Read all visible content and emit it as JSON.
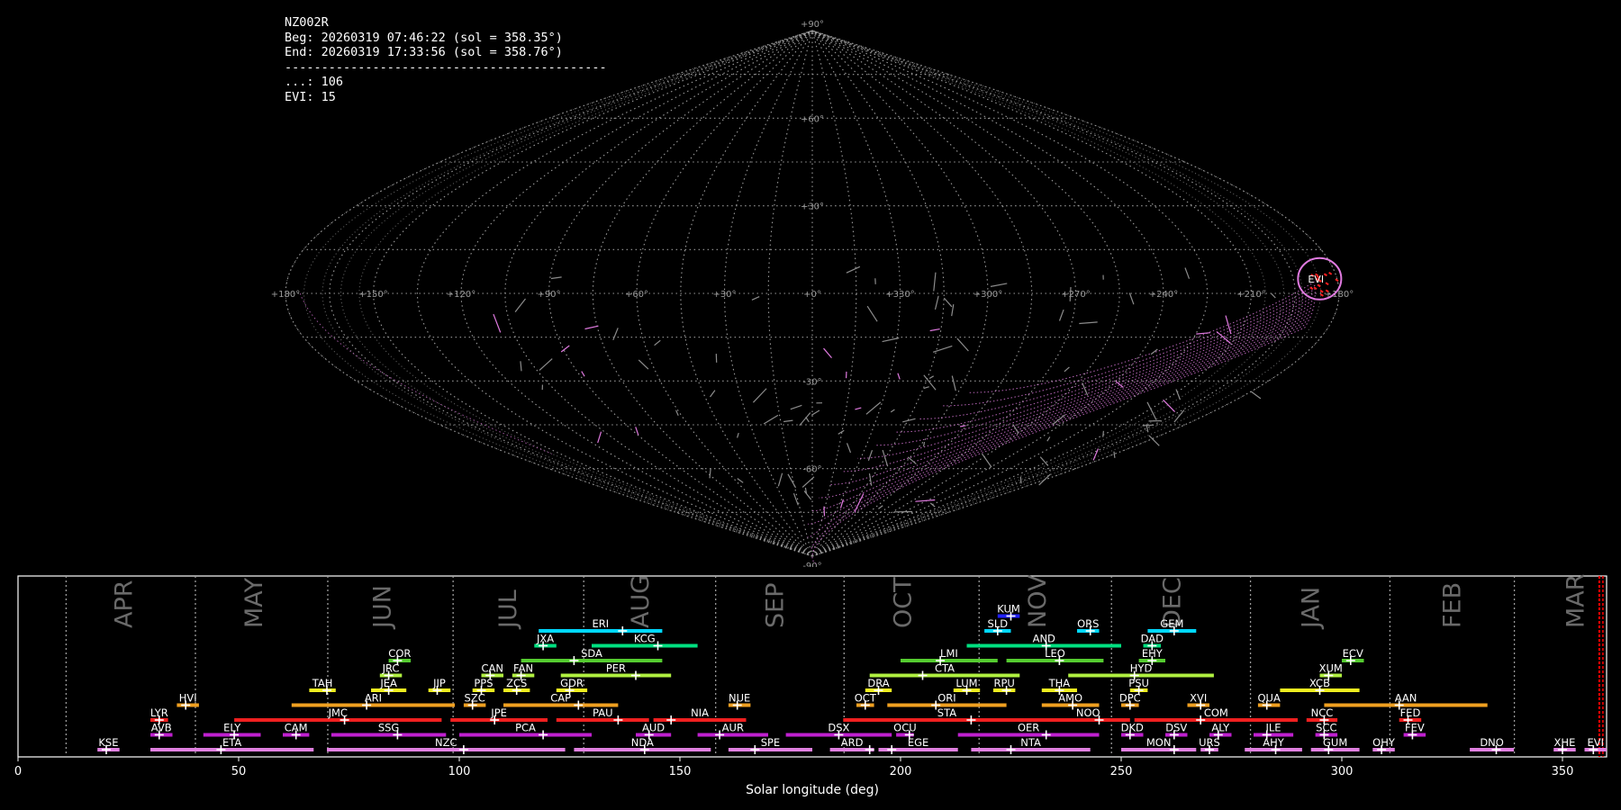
{
  "header": {
    "station": "NZ002R",
    "begin": "Beg: 20260319 07:46:22 (sol = 358.35°)",
    "end": "End: 20260319 17:33:56 (sol = 358.76°)",
    "rule": "--------------------------------------------",
    "count_sporadic": "...: 106",
    "count_evi": "EVI: 15"
  },
  "colors": {
    "background": "#000000",
    "grid": "#9a9a9a",
    "orbit": "#e07ae0",
    "sporadic": "#8c8c8c",
    "radiant_evi": "#ff2020",
    "marker": "#ffffff",
    "current_sol": "#ff0000"
  },
  "chart_data": [
    {
      "type": "scatter",
      "projection": "sinusoidal (equal-area), sky map",
      "lon_labels": [
        "+180°",
        "+150°",
        "+120°",
        "+90°",
        "+60°",
        "+30°",
        "+0°",
        "+330°",
        "+300°",
        "+270°",
        "+240°",
        "+210°",
        "+180°"
      ],
      "lat_labels": [
        "+90°",
        "+60°",
        "+30°",
        "-30°",
        "-60°",
        "-90°"
      ],
      "grid": true,
      "shower_label": "EVI",
      "shower_radiant": {
        "lon": 186,
        "lat": 5
      },
      "meteor_counts": {
        "sporadic": 106,
        "EVI": 15
      }
    },
    {
      "type": "bar",
      "xlabel": "Solar longitude (deg)",
      "xlim": [
        0,
        360
      ],
      "xticks": [
        0,
        50,
        100,
        150,
        200,
        250,
        300,
        350
      ],
      "grid": false,
      "current_sol": 358.35,
      "months": [
        {
          "name": "APR",
          "start": 10.9,
          "mid": 24
        },
        {
          "name": "MAY",
          "start": 40.2,
          "mid": 53.5
        },
        {
          "name": "JUN",
          "start": 70.2,
          "mid": 82.5
        },
        {
          "name": "JUL",
          "start": 98.6,
          "mid": 111
        },
        {
          "name": "AUG",
          "start": 128.2,
          "mid": 141
        },
        {
          "name": "SEP",
          "start": 158.1,
          "mid": 171.5
        },
        {
          "name": "OCT",
          "start": 187.2,
          "mid": 200.5
        },
        {
          "name": "NOV",
          "start": 217.8,
          "mid": 231
        },
        {
          "name": "DEC",
          "start": 247.8,
          "mid": 261.5
        },
        {
          "name": "JAN",
          "start": 279.3,
          "mid": 293
        },
        {
          "name": "FEB",
          "start": 310.9,
          "mid": 325
        },
        {
          "name": "MAR",
          "start": 339.1,
          "mid": 353
        }
      ],
      "showers": [
        {
          "code": "KUM",
          "start": 222,
          "end": 227,
          "peak": 225,
          "row": 9,
          "color": "#2020ff"
        },
        {
          "code": "ERI",
          "start": 118,
          "end": 146,
          "peak": 137,
          "row": 8,
          "color": "#00d8ff"
        },
        {
          "code": "SLD",
          "start": 219,
          "end": 225,
          "peak": 222,
          "row": 8,
          "color": "#00d8ff"
        },
        {
          "code": "ORS",
          "start": 240,
          "end": 245,
          "peak": 243,
          "row": 8,
          "color": "#00d8ff"
        },
        {
          "code": "GEM",
          "start": 256,
          "end": 267,
          "peak": 262,
          "row": 8,
          "color": "#00d8ff"
        },
        {
          "code": "JXA",
          "start": 117,
          "end": 122,
          "peak": 119,
          "row": 7,
          "color": "#00e080"
        },
        {
          "code": "KCG",
          "start": 130,
          "end": 154,
          "peak": 145,
          "row": 7,
          "color": "#00e080"
        },
        {
          "code": "AND",
          "start": 215,
          "end": 250,
          "peak": 233,
          "row": 7,
          "color": "#00e080"
        },
        {
          "code": "DAD",
          "start": 255,
          "end": 259,
          "peak": 257,
          "row": 7,
          "color": "#00e080"
        },
        {
          "code": "COR",
          "start": 84,
          "end": 89,
          "peak": 86,
          "row": 6,
          "color": "#55cc30"
        },
        {
          "code": "SDA",
          "start": 114,
          "end": 146,
          "peak": 126,
          "row": 6,
          "color": "#55cc30"
        },
        {
          "code": "LMI",
          "start": 200,
          "end": 222,
          "peak": 209,
          "row": 6,
          "color": "#55cc30"
        },
        {
          "code": "LEO",
          "start": 224,
          "end": 246,
          "peak": 236,
          "row": 6,
          "color": "#55cc30"
        },
        {
          "code": "EHY",
          "start": 254,
          "end": 260,
          "peak": 257,
          "row": 6,
          "color": "#55cc30"
        },
        {
          "code": "ECV",
          "start": 300,
          "end": 305,
          "peak": 302,
          "row": 6,
          "color": "#55cc30"
        },
        {
          "code": "JRC",
          "start": 82,
          "end": 87,
          "peak": 84,
          "row": 5,
          "color": "#b0f040"
        },
        {
          "code": "CAN",
          "start": 105,
          "end": 110,
          "peak": 107,
          "row": 5,
          "color": "#b0f040"
        },
        {
          "code": "FAN",
          "start": 112,
          "end": 117,
          "peak": 114,
          "row": 5,
          "color": "#b0f040"
        },
        {
          "code": "PER",
          "start": 123,
          "end": 148,
          "peak": 140,
          "row": 5,
          "color": "#b0f040"
        },
        {
          "code": "CTA",
          "start": 193,
          "end": 227,
          "peak": 205,
          "row": 5,
          "color": "#b0f040"
        },
        {
          "code": "HYD",
          "start": 238,
          "end": 271,
          "peak": 253,
          "row": 5,
          "color": "#b0f040"
        },
        {
          "code": "XUM",
          "start": 295,
          "end": 300,
          "peak": 297,
          "row": 5,
          "color": "#b0f040"
        },
        {
          "code": "TAH",
          "start": 66,
          "end": 72,
          "peak": 70,
          "row": 4,
          "color": "#f0f020"
        },
        {
          "code": "JEA",
          "start": 80,
          "end": 88,
          "peak": 84,
          "row": 4,
          "color": "#f0f020"
        },
        {
          "code": "JIP",
          "start": 93,
          "end": 98,
          "peak": 95,
          "row": 4,
          "color": "#f0f020"
        },
        {
          "code": "PPS",
          "start": 103,
          "end": 108,
          "peak": 105,
          "row": 4,
          "color": "#f0f020"
        },
        {
          "code": "ZCS",
          "start": 110,
          "end": 116,
          "peak": 113,
          "row": 4,
          "color": "#f0f020"
        },
        {
          "code": "GDR",
          "start": 122,
          "end": 129,
          "peak": 125,
          "row": 4,
          "color": "#f0f020"
        },
        {
          "code": "DRA",
          "start": 192,
          "end": 198,
          "peak": 195,
          "row": 4,
          "color": "#f0f020"
        },
        {
          "code": "LUM",
          "start": 212,
          "end": 218,
          "peak": 215,
          "row": 4,
          "color": "#f0f020"
        },
        {
          "code": "RPU",
          "start": 221,
          "end": 226,
          "peak": 224,
          "row": 4,
          "color": "#f0f020"
        },
        {
          "code": "THA",
          "start": 232,
          "end": 240,
          "peak": 236,
          "row": 4,
          "color": "#f0f020"
        },
        {
          "code": "PSU",
          "start": 252,
          "end": 256,
          "peak": 254,
          "row": 4,
          "color": "#f0f020"
        },
        {
          "code": "XCB",
          "start": 286,
          "end": 304,
          "peak": 295,
          "row": 4,
          "color": "#f0f020"
        },
        {
          "code": "HVI",
          "start": 36,
          "end": 41,
          "peak": 38,
          "row": 3,
          "color": "#f0a020"
        },
        {
          "code": "ARI",
          "start": 62,
          "end": 99,
          "peak": 79,
          "row": 3,
          "color": "#f0a020"
        },
        {
          "code": "SZC",
          "start": 101,
          "end": 106,
          "peak": 103,
          "row": 3,
          "color": "#f0a020"
        },
        {
          "code": "CAP",
          "start": 110,
          "end": 136,
          "peak": 127,
          "row": 3,
          "color": "#f0a020"
        },
        {
          "code": "NUE",
          "start": 161,
          "end": 166,
          "peak": 163,
          "row": 3,
          "color": "#f0a020"
        },
        {
          "code": "OCT",
          "start": 190,
          "end": 194,
          "peak": 192,
          "row": 3,
          "color": "#f0a020"
        },
        {
          "code": "ORI",
          "start": 197,
          "end": 224,
          "peak": 208,
          "row": 3,
          "color": "#f0a020"
        },
        {
          "code": "AMO",
          "start": 232,
          "end": 245,
          "peak": 239,
          "row": 3,
          "color": "#f0a020"
        },
        {
          "code": "DPC",
          "start": 250,
          "end": 254,
          "peak": 252,
          "row": 3,
          "color": "#f0a020"
        },
        {
          "code": "XVI",
          "start": 265,
          "end": 270,
          "peak": 268,
          "row": 3,
          "color": "#f0a020"
        },
        {
          "code": "QUA",
          "start": 281,
          "end": 286,
          "peak": 283,
          "row": 3,
          "color": "#f0a020"
        },
        {
          "code": "AAN",
          "start": 296,
          "end": 333,
          "peak": 313,
          "row": 3,
          "color": "#f0a020"
        },
        {
          "code": "LYR",
          "start": 30,
          "end": 34,
          "peak": 32,
          "row": 2,
          "color": "#f02020"
        },
        {
          "code": "JMC",
          "start": 49,
          "end": 96,
          "peak": 74,
          "row": 2,
          "color": "#f02020"
        },
        {
          "code": "JPE",
          "start": 98,
          "end": 120,
          "peak": 108,
          "row": 2,
          "color": "#f02020"
        },
        {
          "code": "PAU",
          "start": 122,
          "end": 143,
          "peak": 136,
          "row": 2,
          "color": "#f02020"
        },
        {
          "code": "NIA",
          "start": 144,
          "end": 165,
          "peak": 148,
          "row": 2,
          "color": "#f02020"
        },
        {
          "code": "STA",
          "start": 187,
          "end": 234,
          "peak": 216,
          "row": 2,
          "color": "#f02020"
        },
        {
          "code": "NOO",
          "start": 233,
          "end": 252,
          "peak": 245,
          "row": 2,
          "color": "#f02020"
        },
        {
          "code": "COM",
          "start": 253,
          "end": 290,
          "peak": 268,
          "row": 2,
          "color": "#f02020"
        },
        {
          "code": "NCC",
          "start": 292,
          "end": 299,
          "peak": 296,
          "row": 2,
          "color": "#f02020"
        },
        {
          "code": "FED",
          "start": 313,
          "end": 318,
          "peak": 315,
          "row": 2,
          "color": "#f02020"
        },
        {
          "code": "AVB",
          "start": 30,
          "end": 35,
          "peak": 32,
          "row": 1,
          "color": "#c020d0"
        },
        {
          "code": "ELY",
          "start": 42,
          "end": 55,
          "peak": 49,
          "row": 1,
          "color": "#c020d0"
        },
        {
          "code": "CAM",
          "start": 60,
          "end": 66,
          "peak": 63,
          "row": 1,
          "color": "#c020d0"
        },
        {
          "code": "SSG",
          "start": 71,
          "end": 97,
          "peak": 86,
          "row": 1,
          "color": "#c020d0"
        },
        {
          "code": "PCA",
          "start": 100,
          "end": 130,
          "peak": 119,
          "row": 1,
          "color": "#c020d0"
        },
        {
          "code": "AUD",
          "start": 140,
          "end": 148,
          "peak": 143,
          "row": 1,
          "color": "#c020d0"
        },
        {
          "code": "AUR",
          "start": 154,
          "end": 170,
          "peak": 159,
          "row": 1,
          "color": "#c020d0"
        },
        {
          "code": "DSX",
          "start": 174,
          "end": 198,
          "peak": 186,
          "row": 1,
          "color": "#c020d0"
        },
        {
          "code": "OCU",
          "start": 199,
          "end": 203,
          "peak": 202,
          "row": 1,
          "color": "#c020d0"
        },
        {
          "code": "OER",
          "start": 213,
          "end": 245,
          "peak": 233,
          "row": 1,
          "color": "#c020d0"
        },
        {
          "code": "DKD",
          "start": 250,
          "end": 255,
          "peak": 252,
          "row": 1,
          "color": "#c020d0"
        },
        {
          "code": "DSV",
          "start": 260,
          "end": 265,
          "peak": 262,
          "row": 1,
          "color": "#c020d0"
        },
        {
          "code": "ALY",
          "start": 270,
          "end": 275,
          "peak": 272,
          "row": 1,
          "color": "#c020d0"
        },
        {
          "code": "ILE",
          "start": 280,
          "end": 289,
          "peak": 283,
          "row": 1,
          "color": "#c020d0"
        },
        {
          "code": "SCC",
          "start": 294,
          "end": 299,
          "peak": 296,
          "row": 1,
          "color": "#c020d0"
        },
        {
          "code": "FEV",
          "start": 314,
          "end": 319,
          "peak": 316,
          "row": 1,
          "color": "#c020d0"
        },
        {
          "code": "KSE",
          "start": 18,
          "end": 23,
          "peak": 20,
          "row": 0,
          "color": "#e080e0"
        },
        {
          "code": "ETA",
          "start": 30,
          "end": 67,
          "peak": 46,
          "row": 0,
          "color": "#e080e0"
        },
        {
          "code": "NZC",
          "start": 70,
          "end": 124,
          "peak": 101,
          "row": 0,
          "color": "#e080e0"
        },
        {
          "code": "NDA",
          "start": 126,
          "end": 157,
          "peak": 142,
          "row": 0,
          "color": "#e080e0"
        },
        {
          "code": "SPE",
          "start": 161,
          "end": 180,
          "peak": 167,
          "row": 0,
          "color": "#e080e0"
        },
        {
          "code": "ARD",
          "start": 184,
          "end": 194,
          "peak": 193,
          "row": 0,
          "color": "#e080e0"
        },
        {
          "code": "EGE",
          "start": 195,
          "end": 213,
          "peak": 198,
          "row": 0,
          "color": "#e080e0"
        },
        {
          "code": "NTA",
          "start": 216,
          "end": 243,
          "peak": 225,
          "row": 0,
          "color": "#e080e0"
        },
        {
          "code": "MON",
          "start": 250,
          "end": 267,
          "peak": 262,
          "row": 0,
          "color": "#e080e0"
        },
        {
          "code": "URS",
          "start": 268,
          "end": 272,
          "peak": 270,
          "row": 0,
          "color": "#e080e0"
        },
        {
          "code": "AHY",
          "start": 278,
          "end": 291,
          "peak": 285,
          "row": 0,
          "color": "#e080e0"
        },
        {
          "code": "GUM",
          "start": 293,
          "end": 304,
          "peak": 297,
          "row": 0,
          "color": "#e080e0"
        },
        {
          "code": "OHY",
          "start": 307,
          "end": 312,
          "peak": 309,
          "row": 0,
          "color": "#e080e0"
        },
        {
          "code": "DNO",
          "start": 329,
          "end": 339,
          "peak": 335,
          "row": 0,
          "color": "#e080e0"
        },
        {
          "code": "XHE",
          "start": 348,
          "end": 353,
          "peak": 350,
          "row": 0,
          "color": "#e080e0"
        },
        {
          "code": "EVI",
          "start": 355,
          "end": 360,
          "peak": 357,
          "row": 0,
          "color": "#e080e0"
        }
      ]
    }
  ]
}
